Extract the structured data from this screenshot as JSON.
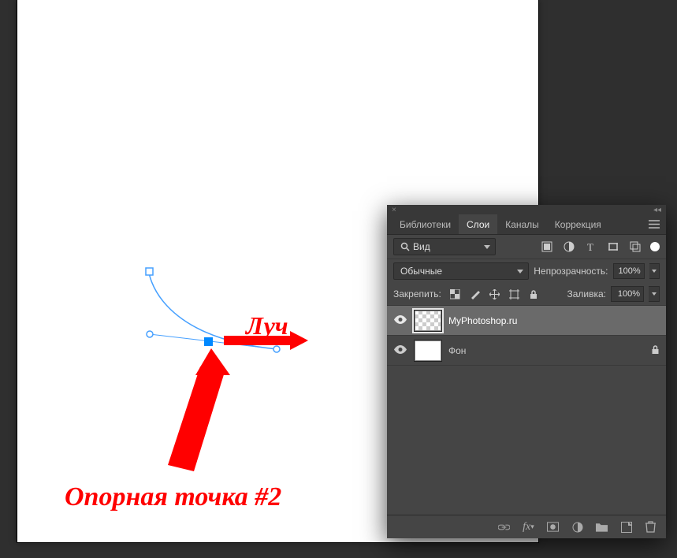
{
  "annotations": {
    "ray": "Луч",
    "anchor_point": "Опорная точка #2"
  },
  "panel": {
    "tabs": {
      "libraries": "Библиотеки",
      "layers": "Слои",
      "channels": "Каналы",
      "adjustments": "Коррекция"
    },
    "filter": {
      "label": "Вид"
    },
    "blend_mode": "Обычные",
    "opacity": {
      "label": "Непрозрачность:",
      "value": "100%"
    },
    "lock": {
      "label": "Закрепить:"
    },
    "fill": {
      "label": "Заливка:",
      "value": "100%"
    },
    "layers": [
      {
        "name": "MyPhotoshop.ru",
        "visible": true,
        "selected": true,
        "transparent": true,
        "locked": false
      },
      {
        "name": "Фон",
        "visible": true,
        "selected": false,
        "transparent": false,
        "locked": true
      }
    ]
  },
  "colors": {
    "accent_red": "#ff0000",
    "anchor_blue": "#0088ff",
    "panel_bg": "#454545",
    "panel_dark": "#383838"
  }
}
